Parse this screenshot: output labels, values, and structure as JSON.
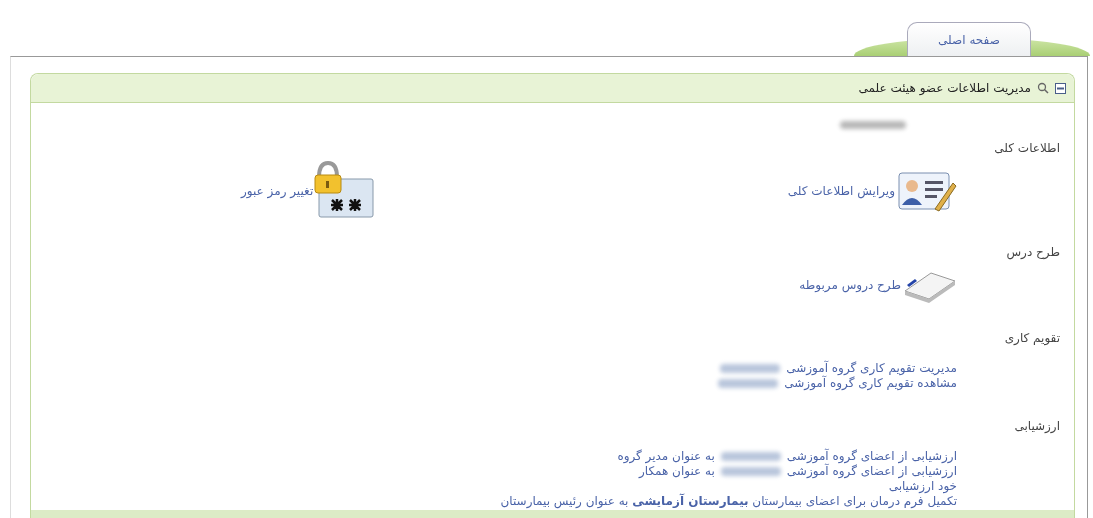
{
  "tabs": [
    {
      "label": "صفحه اصلی",
      "selected": true
    }
  ],
  "panel": {
    "title": "مدیریت اطلاعات عضو هیئت علمی",
    "expanded": true
  },
  "sections": [
    {
      "label": "اطلاعات کلی",
      "name_blurred": true,
      "items": [
        {
          "kind": "icon",
          "text": "ویرایش اطلاعات کلی"
        },
        {
          "kind": "icon",
          "text": "تغییر رمز عبور"
        }
      ]
    },
    {
      "label": "طرح درس",
      "items": [
        {
          "kind": "icon",
          "text": "طرح دروس مربوطه"
        }
      ]
    },
    {
      "label": "تقویم کاری",
      "items": [
        {
          "kind": "link",
          "parts": [
            "مدیریت تقویم کاری گروه آموزشی"
          ],
          "blurred": true
        },
        {
          "kind": "link",
          "parts": [
            "مشاهده تقویم کاری گروه آموزشی"
          ],
          "blurred": true
        }
      ]
    },
    {
      "label": "ارزشیابی",
      "items": [
        {
          "kind": "link",
          "parts": [
            "ارزشیابی از اعضای گروه آموزشی",
            "به عنوان مدیر گروه"
          ],
          "blurred": true
        },
        {
          "kind": "link",
          "parts": [
            "ارزشیابی از اعضای گروه آموزشی",
            "به عنوان همکار"
          ],
          "blurred": true
        },
        {
          "kind": "link",
          "parts": [
            "خود ارزشیابی"
          ],
          "blurred": false
        },
        {
          "kind": "link",
          "parts": [
            "تکمیل فرم درمان برای اعضای بیمارستان **بیمارستان آزمایشی** به عنوان رئیس بیمارستان"
          ],
          "blurred": false
        }
      ]
    }
  ]
}
